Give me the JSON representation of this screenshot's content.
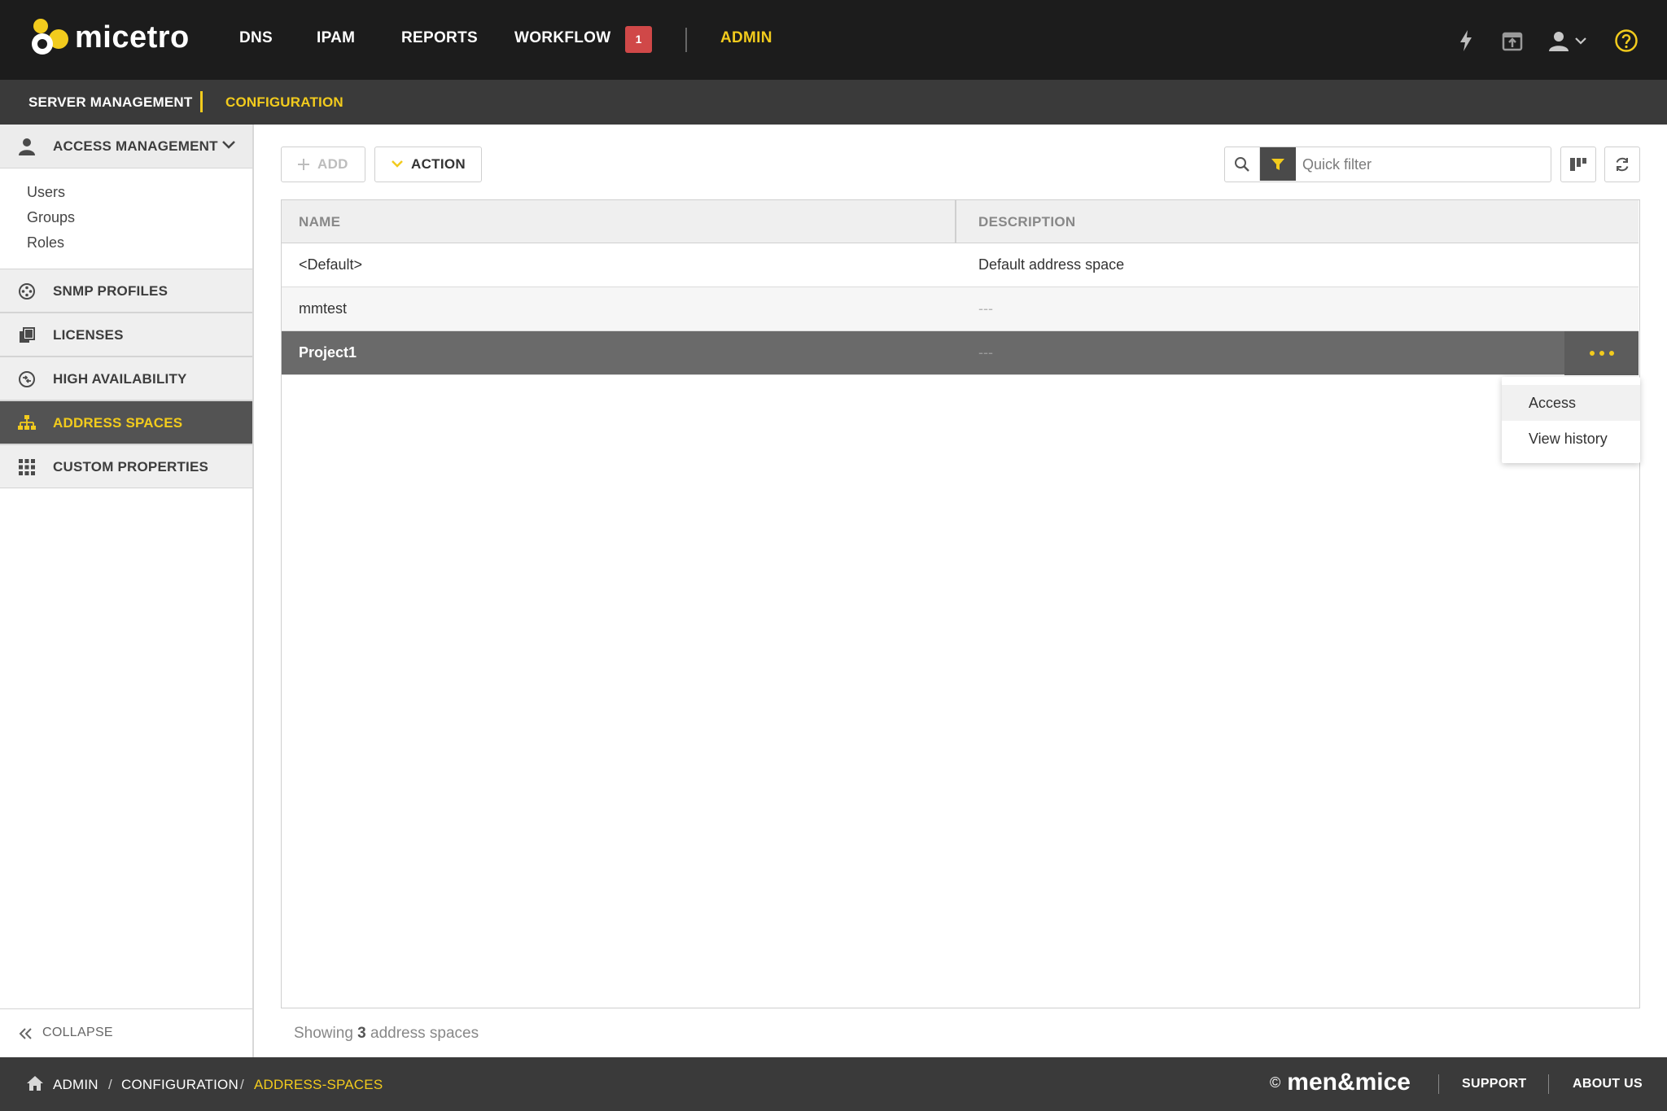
{
  "app": {
    "logo_text": "micetro",
    "nav": [
      {
        "label": "DNS"
      },
      {
        "label": "IPAM"
      },
      {
        "label": "REPORTS"
      },
      {
        "label": "WORKFLOW"
      },
      {
        "label": "ADMIN"
      }
    ],
    "workflow_badge": "1",
    "icons": [
      "lightning-icon",
      "upload-box-icon",
      "user-icon",
      "chevron-down-icon",
      "help-icon"
    ]
  },
  "subnav": {
    "items": [
      {
        "label": "SERVER MANAGEMENT"
      },
      {
        "label": "CONFIGURATION",
        "active": true
      }
    ]
  },
  "sidebar": {
    "access_header": "ACCESS MANAGEMENT",
    "access_links": [
      "Users",
      "Groups",
      "Roles"
    ],
    "items": [
      {
        "label": "SNMP PROFILES",
        "icon": "snmp-icon"
      },
      {
        "label": "LICENSES",
        "icon": "licenses-icon"
      },
      {
        "label": "HIGH AVAILABILITY",
        "icon": "high-availability-icon"
      },
      {
        "label": "ADDRESS SPACES",
        "icon": "address-spaces-icon",
        "active": true
      },
      {
        "label": "CUSTOM PROPERTIES",
        "icon": "grid-icon"
      }
    ],
    "collapse_label": "COLLAPSE"
  },
  "toolbar": {
    "add_label": "ADD",
    "action_label": "ACTION",
    "quick_filter_placeholder": "Quick filter"
  },
  "table": {
    "columns": [
      "NAME",
      "DESCRIPTION"
    ],
    "rows": [
      {
        "name": "<Default>",
        "description": "Default address space"
      },
      {
        "name": "mmtest",
        "description": "---"
      },
      {
        "name": "Project1",
        "description": "---",
        "selected": true
      }
    ]
  },
  "context_menu": {
    "items": [
      "Access",
      "View history"
    ]
  },
  "status": {
    "prefix": "Showing",
    "count": "3",
    "suffix": "address spaces"
  },
  "footer": {
    "breadcrumb": [
      "ADMIN",
      "CONFIGURATION",
      "ADDRESS-SPACES"
    ],
    "brand": "men&mice",
    "copyright": "©",
    "links": [
      "SUPPORT",
      "ABOUT US"
    ]
  },
  "colors": {
    "accent": "#f2cb1d",
    "topbar": "#1c1c1c",
    "subnav": "#3a3a3a",
    "badge": "#d04848",
    "selected_row": "#6a6a6a"
  }
}
